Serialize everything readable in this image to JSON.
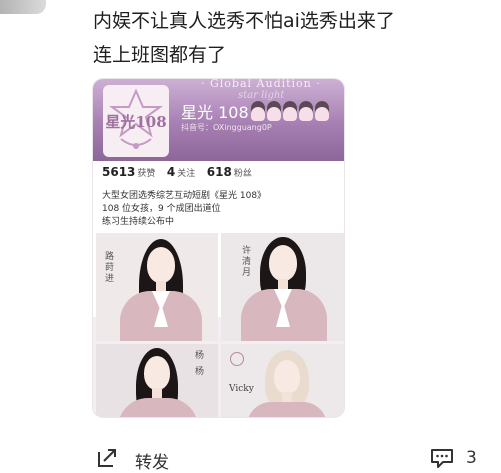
{
  "post": {
    "lines": [
      "内娱不让真人选秀不怕ai选秀出来了",
      "连上班图都有了"
    ]
  },
  "embed": {
    "banner_line1": "· Global Audition ·",
    "banner_line2": "star light",
    "logo_text": "星光108",
    "account_name": "星光 108",
    "account_id": "抖音号：OXingguang0P",
    "stats": [
      {
        "value": "5613",
        "label": "获赞"
      },
      {
        "value": "4",
        "label": "关注"
      },
      {
        "value": "618",
        "label": "粉丝"
      }
    ],
    "bio": [
      "大型女团选秀综艺互动短剧《星光 108》",
      "108 位女孩，9 个成团出道位",
      "练习生持续公布中"
    ],
    "trainees": [
      {
        "name": "路莳进"
      },
      {
        "name": "许清月"
      },
      {
        "name": "杨 杨"
      },
      {
        "name": "Vicky"
      }
    ],
    "colors": {
      "banner": "#a77fb3",
      "jacket": "#d8b7be"
    }
  },
  "actions": {
    "repost_label": "转发",
    "comment_count": "3"
  }
}
